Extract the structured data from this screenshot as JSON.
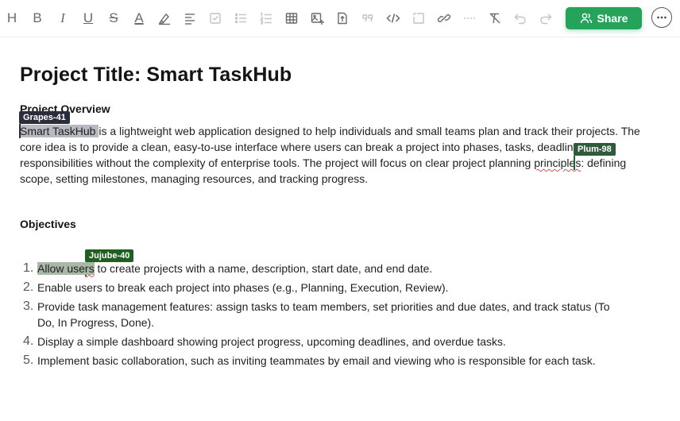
{
  "toolbar": {
    "buttons": [
      {
        "name": "heading-button",
        "glyph": "H",
        "icon": "heading-icon"
      },
      {
        "name": "bold-button",
        "glyph": "B",
        "icon": "bold-icon"
      },
      {
        "name": "italic-button",
        "glyph": "I",
        "icon": "italic-icon"
      },
      {
        "name": "underline-button",
        "glyph": "U",
        "icon": "underline-icon"
      },
      {
        "name": "strikethrough-button",
        "glyph": "S",
        "icon": "strikethrough-icon"
      },
      {
        "name": "text-color-button",
        "glyph": "A",
        "icon": "text-color-icon"
      },
      {
        "name": "highlight-button",
        "icon": "highlighter-icon"
      },
      {
        "name": "align-button",
        "icon": "align-left-icon"
      },
      {
        "name": "checklist-button",
        "icon": "checkbox-icon"
      },
      {
        "name": "bullet-list-button",
        "icon": "bullet-list-icon"
      },
      {
        "name": "numbered-list-button",
        "icon": "numbered-list-icon"
      },
      {
        "name": "table-button",
        "icon": "table-icon"
      },
      {
        "name": "image-button",
        "icon": "image-icon"
      },
      {
        "name": "file-button",
        "icon": "file-upload-icon"
      },
      {
        "name": "quote-button",
        "icon": "quote-icon"
      },
      {
        "name": "code-button",
        "icon": "code-icon"
      },
      {
        "name": "embed-button",
        "icon": "embed-icon"
      },
      {
        "name": "link-button",
        "icon": "link-icon"
      },
      {
        "name": "divider-button",
        "icon": "horizontal-rule-icon"
      },
      {
        "name": "clear-format-button",
        "icon": "clear-format-icon"
      },
      {
        "name": "undo-button",
        "icon": "undo-icon"
      },
      {
        "name": "redo-button",
        "icon": "redo-icon"
      }
    ],
    "share_label": "Share",
    "share_color": "#25a35a"
  },
  "document": {
    "title": "Project Title: Smart TaskHub",
    "overview_heading": "Project Overview",
    "overview": {
      "p1_highlight": "Smart TaskHub ",
      "p1_rest": "is a lightweight web application designed to help individuals and small teams plan and track their projects. The core idea is to provide a clean, easy-to-use interface where users can break a project into phases, tasks, deadlines, and responsibilities without the complexity of enterprise tools. The project will focus on clear project planning ",
      "p1_squiggle": "principles",
      "p1_end": ": defining scope, setting milestones, managing resources, and tracking progress."
    },
    "objectives_heading": "Objectives",
    "objectives": [
      {
        "num": "1.",
        "highlight": "Allow use",
        "squiggle": "rs",
        "rest": " to create projects with a name, description, start date, and end date."
      },
      {
        "num": "2.",
        "text": "Enable users to break each project into phases (e.g., Planning, Execution, Review)."
      },
      {
        "num": "3.",
        "text": "Provide task management features: assign tasks to team members, set priorities and due dates, and track status (To Do, In Progress, Done)."
      },
      {
        "num": "4.",
        "text": "Display a simple dashboard showing project progress, upcoming deadlines, and overdue tasks."
      },
      {
        "num": "5.",
        "text": "Implement basic collaboration, such as inviting teammates by email and viewing who is responsible for each task."
      }
    ]
  },
  "collaborators": [
    {
      "label": "Grapes-41",
      "color": "#2b2d3d"
    },
    {
      "label": "Plum-98",
      "color": "#2f5a3c"
    },
    {
      "label": "Jujube-40",
      "color": "#1f5f22"
    }
  ]
}
